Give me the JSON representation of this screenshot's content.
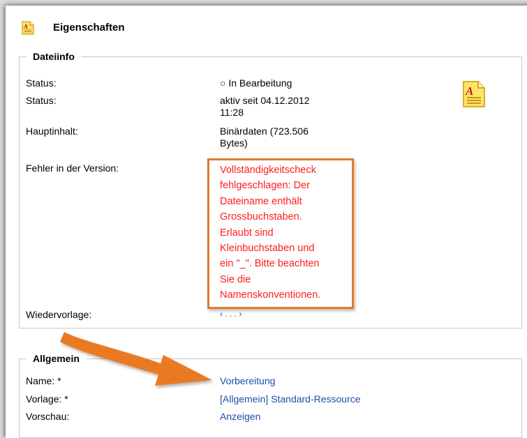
{
  "header": {
    "title": "Eigenschaften"
  },
  "dateiinfo": {
    "legend": "Dateiinfo",
    "rows": [
      {
        "label": "Status:",
        "value": "○ In Bearbeitung"
      },
      {
        "label": "Status:",
        "value_lines": [
          "aktiv seit 04.12.2012",
          "11:28"
        ]
      },
      {
        "label": "Hauptinhalt:",
        "value_lines": [
          "Binärdaten (723.506",
          "Bytes)"
        ]
      },
      {
        "label": "Fehler in der Version:",
        "value_lines": [
          "Vollständigkeitscheck",
          "fehlgeschlagen: Der",
          "Dateiname enthält",
          "Grossbuchstaben.",
          "Erlaubt sind",
          "Kleinbuchstaben und",
          "ein \"_\". Bitte beachten",
          "Sie die",
          "Namenskonventionen."
        ]
      },
      {
        "label": "Wiedervorlage:",
        "value": "‹ . . . ›"
      }
    ]
  },
  "allgemein": {
    "legend": "Allgemein",
    "rows": [
      {
        "label": "Name: *",
        "value": "Vorbereitung"
      },
      {
        "label": "Vorlage: *",
        "value": "[Allgemein] Standard-Ressource"
      },
      {
        "label": "Vorschau:",
        "value": "Anzeigen"
      }
    ]
  },
  "colors": {
    "error": "#ff1c1c",
    "link": "#1d4ea8",
    "highlight": "#e07b2b"
  },
  "icons": [
    "document-icon",
    "arrow-annotation"
  ]
}
